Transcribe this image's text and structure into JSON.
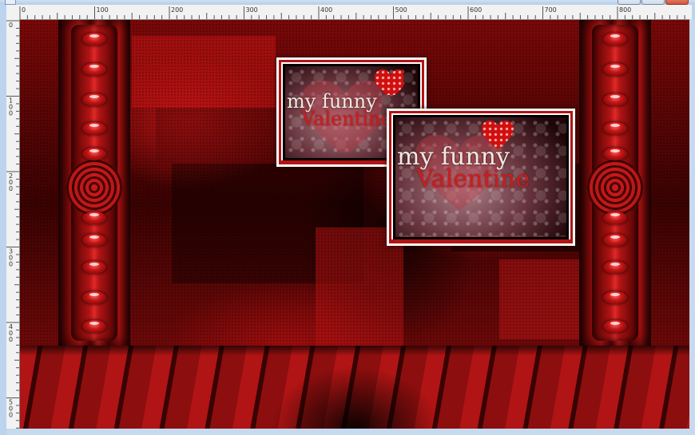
{
  "window": {
    "title": ""
  },
  "ruler": {
    "h_labels": [
      "0",
      "100",
      "200",
      "300",
      "400",
      "500",
      "600",
      "700",
      "800"
    ],
    "v_labels": [
      "0",
      "100",
      "200",
      "300",
      "400",
      "500"
    ]
  },
  "cards": [
    {
      "line1": "my funny",
      "line2": "Valentine"
    },
    {
      "line1": "my funny",
      "line2": "Valentine"
    }
  ],
  "colors": {
    "accent": "#b31414",
    "ruler_bg": "#f2f2f2",
    "chrome": "#bcd4ee"
  }
}
